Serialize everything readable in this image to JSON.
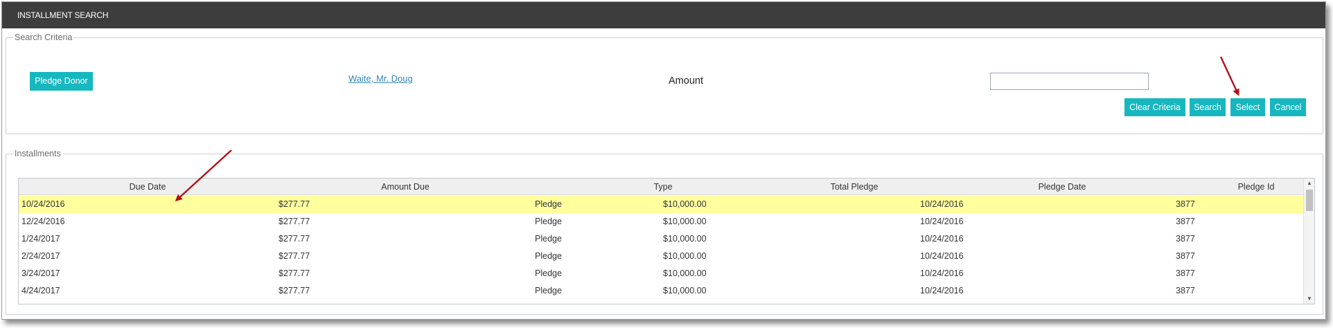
{
  "window": {
    "title": "INSTALLMENT SEARCH"
  },
  "criteria": {
    "legend": "Search Criteria",
    "pledge_donor_button": "Pledge Donor",
    "donor_name": "Waite, Mr. Doug",
    "amount_label": "Amount",
    "amount_value": "",
    "buttons": {
      "clear": "Clear Criteria",
      "search": "Search",
      "select": "Select",
      "cancel": "Cancel"
    }
  },
  "installments": {
    "legend": "Installments",
    "columns": {
      "due_date": "Due Date",
      "amount_due": "Amount Due",
      "type": "Type",
      "total_pledge": "Total Pledge",
      "pledge_date": "Pledge Date",
      "pledge_id": "Pledge Id"
    },
    "rows": [
      {
        "due_date": "10/24/2016",
        "amount_due": "$277.77",
        "type": "Pledge",
        "total_pledge": "$10,000.00",
        "pledge_date": "10/24/2016",
        "pledge_id": "3877",
        "selected": true
      },
      {
        "due_date": "12/24/2016",
        "amount_due": "$277.77",
        "type": "Pledge",
        "total_pledge": "$10,000.00",
        "pledge_date": "10/24/2016",
        "pledge_id": "3877",
        "selected": false
      },
      {
        "due_date": "1/24/2017",
        "amount_due": "$277.77",
        "type": "Pledge",
        "total_pledge": "$10,000.00",
        "pledge_date": "10/24/2016",
        "pledge_id": "3877",
        "selected": false
      },
      {
        "due_date": "2/24/2017",
        "amount_due": "$277.77",
        "type": "Pledge",
        "total_pledge": "$10,000.00",
        "pledge_date": "10/24/2016",
        "pledge_id": "3877",
        "selected": false
      },
      {
        "due_date": "3/24/2017",
        "amount_due": "$277.77",
        "type": "Pledge",
        "total_pledge": "$10,000.00",
        "pledge_date": "10/24/2016",
        "pledge_id": "3877",
        "selected": false
      },
      {
        "due_date": "4/24/2017",
        "amount_due": "$277.77",
        "type": "Pledge",
        "total_pledge": "$10,000.00",
        "pledge_date": "10/24/2016",
        "pledge_id": "3877",
        "selected": false
      }
    ]
  },
  "colors": {
    "titlebar": "#3d3d3d",
    "button": "#17b7bf",
    "selected_row": "#ffff9e",
    "annotation_arrow": "#b01218"
  },
  "icons": {
    "scroll_up": "scroll-up-icon",
    "scroll_down": "scroll-down-icon",
    "annotation": "annotation-arrow-icon"
  }
}
